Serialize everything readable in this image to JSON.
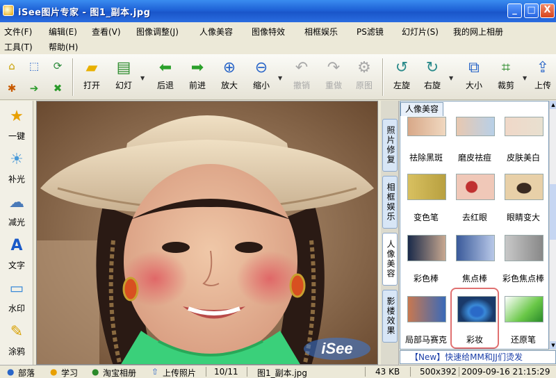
{
  "window": {
    "title": "iSee图片专家 - 图1_副本.jpg",
    "min_label": "_",
    "max_label": "□",
    "close_label": "X"
  },
  "menu": [
    "文件(F)",
    "编辑(E)",
    "查看(V)",
    "图像调整(J)",
    "人像美容",
    "图像特效",
    "相框娱乐",
    "PS滤镜",
    "幻灯片(S)",
    "我的网上相册",
    "工具(T)",
    "帮助(H)"
  ],
  "toolbar": {
    "open": "打开",
    "slideshow": "幻灯",
    "back": "后退",
    "forward": "前进",
    "zoom_in": "放大",
    "zoom_out": "缩小",
    "undo": "撤销",
    "redo": "重做",
    "restore": "原图",
    "rotate_left": "左旋",
    "rotate_right": "右旋",
    "resize": "大小",
    "crop": "裁剪",
    "upload": "上传"
  },
  "left_tools": [
    "一键",
    "补光",
    "减光",
    "文字",
    "水印",
    "涂鸦"
  ],
  "side_tabs": {
    "close": "X",
    "items": [
      "照片修复",
      "相框娱乐",
      "人像美容",
      "影楼效果"
    ]
  },
  "panel": {
    "tab": "人像美容",
    "effects": [
      "祛除黑斑",
      "磨皮祛痘",
      "皮肤美白",
      "变色笔",
      "去红眼",
      "眼睛变大",
      "彩色棒",
      "焦点棒",
      "彩色焦点棒",
      "局部马赛克",
      "彩妆",
      "还原笔"
    ],
    "selected": "彩妆"
  },
  "news": "【New】快速给MM和JJ们烫发",
  "watermark": "iSee",
  "status": {
    "links": [
      "部落",
      "学习",
      "淘宝相册",
      "上传照片"
    ],
    "index": "10/11",
    "filename": "图1_副本.jpg",
    "filesize": "43 KB",
    "dimensions": "500x392",
    "datetime": "2009-09-16 21:15:29"
  },
  "colors": {
    "titlebar": "#1f62d6",
    "selection_outline": "#e07070",
    "news_text": "#1a3ea8"
  }
}
